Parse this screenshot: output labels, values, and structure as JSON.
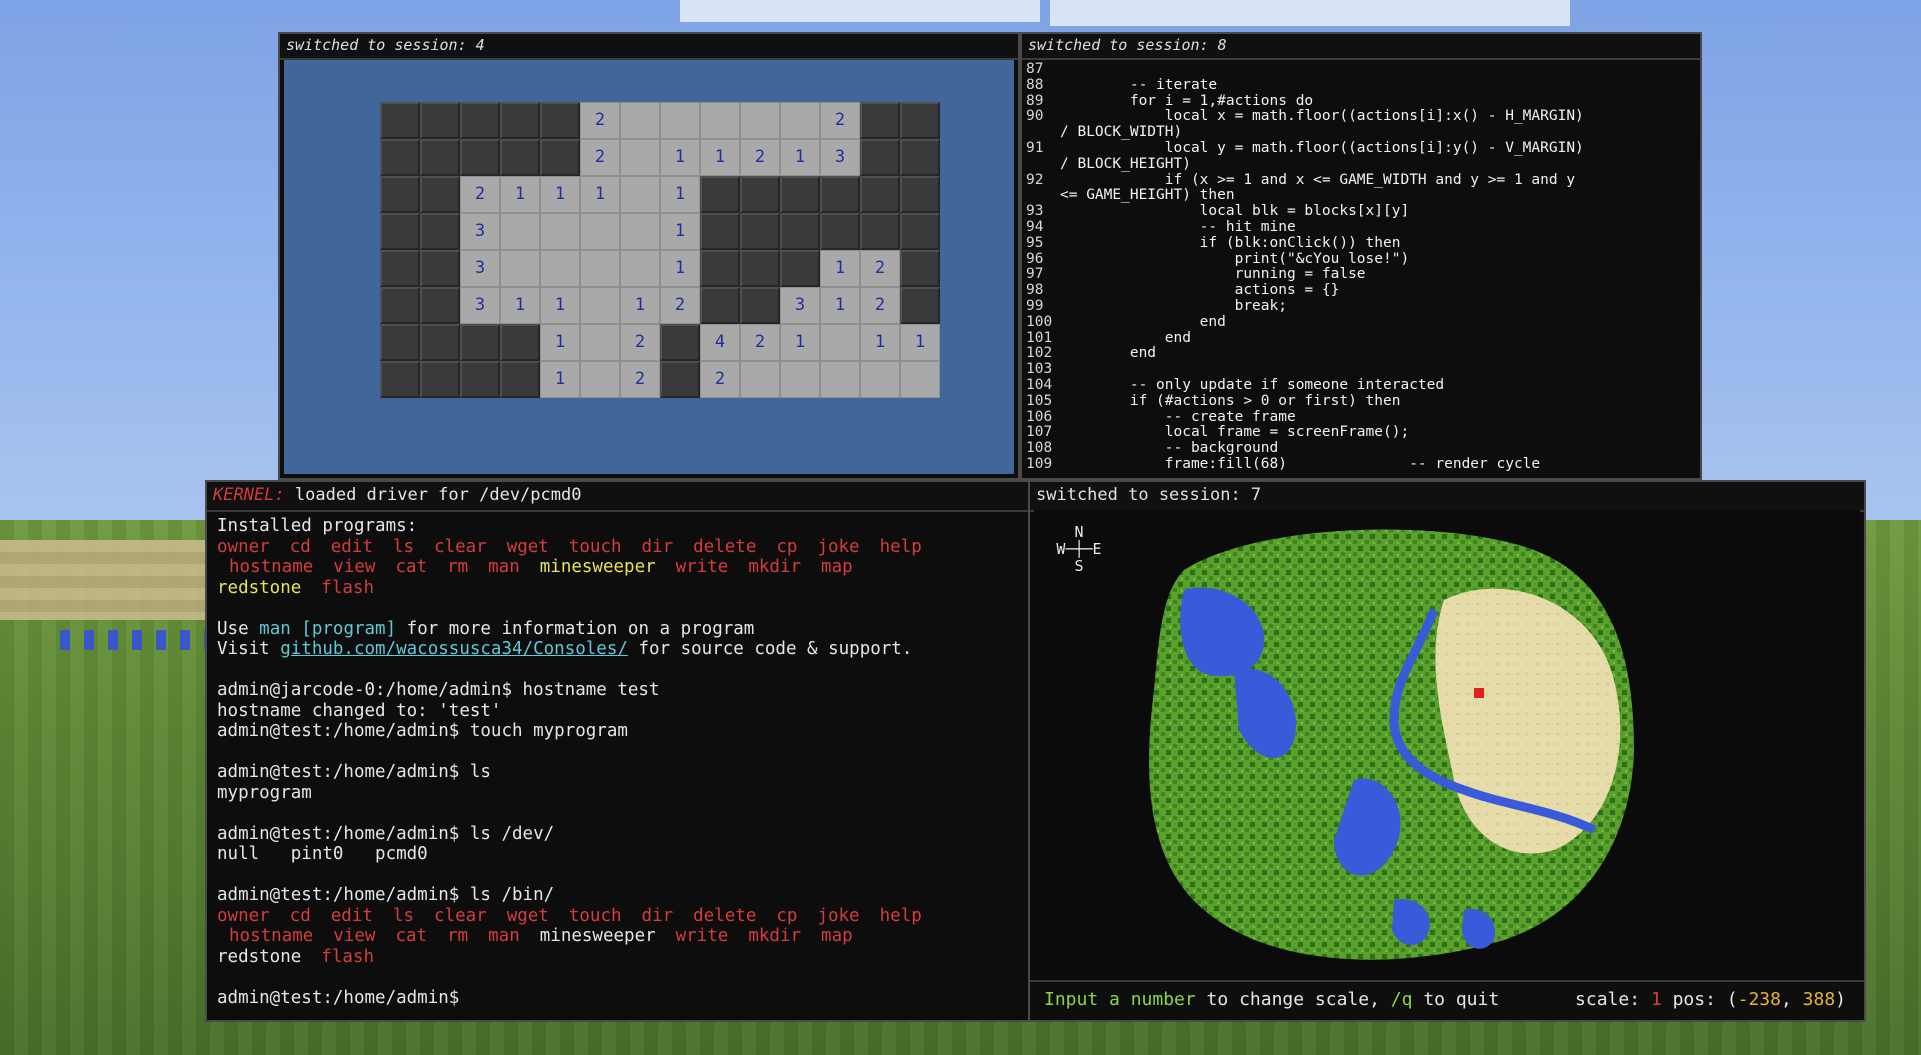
{
  "game_pane": {
    "header": "switched to session: 4",
    "grid": [
      [
        "h",
        "h",
        "h",
        "h",
        "h",
        "o:2",
        "o",
        "o",
        "o",
        "o",
        "o",
        "o:2",
        "h",
        "h"
      ],
      [
        "h",
        "h",
        "h",
        "h",
        "h",
        "o:2",
        "o",
        "o:1",
        "o:1",
        "o:2",
        "o:1",
        "o:3",
        "h",
        "h"
      ],
      [
        "h",
        "h",
        "o:2",
        "o:1",
        "o:1",
        "o:1",
        "o",
        "o:1",
        "h",
        "h",
        "h",
        "h",
        "h",
        "h"
      ],
      [
        "h",
        "h",
        "o:3",
        "o",
        "o",
        "o",
        "o",
        "o:1",
        "h",
        "h",
        "h",
        "h",
        "h",
        "h"
      ],
      [
        "h",
        "h",
        "o:3",
        "o",
        "o",
        "o",
        "o",
        "o:1",
        "h",
        "h",
        "h",
        "o:1",
        "o:2",
        "h"
      ],
      [
        "h",
        "h",
        "o:3",
        "o:1",
        "o:1",
        "o",
        "o:1",
        "o:2",
        "h",
        "h",
        "o:3",
        "o:1",
        "o:2",
        "h"
      ],
      [
        "h",
        "h",
        "h",
        "h",
        "o:1",
        "o",
        "o:2",
        "h",
        "o:4",
        "o:2",
        "o:1",
        "o",
        "o:1",
        "o:1"
      ],
      [
        "h",
        "h",
        "h",
        "h",
        "o:1",
        "o",
        "o:2",
        "h",
        "o:2",
        "o",
        "o",
        "o",
        "o",
        "o"
      ]
    ]
  },
  "code_pane": {
    "header": "switched to session: 8",
    "lines": [
      {
        "n": "87",
        "t": ""
      },
      {
        "n": "88",
        "t": "        -- iterate"
      },
      {
        "n": "89",
        "t": "        for i = 1,#actions do"
      },
      {
        "n": "90",
        "t": "            local x = math.floor((actions[i]:x() - H_MARGIN)"
      },
      {
        "n": "",
        "t": "/ BLOCK_WIDTH)"
      },
      {
        "n": "91",
        "t": "            local y = math.floor((actions[i]:y() - V_MARGIN)"
      },
      {
        "n": "",
        "t": "/ BLOCK_HEIGHT)"
      },
      {
        "n": "92",
        "t": "            if (x >= 1 and x <= GAME_WIDTH and y >= 1 and y"
      },
      {
        "n": "",
        "t": "<= GAME_HEIGHT) then"
      },
      {
        "n": "93",
        "t": "                local blk = blocks[x][y]"
      },
      {
        "n": "94",
        "t": "                -- hit mine"
      },
      {
        "n": "95",
        "t": "                if (blk:onClick()) then"
      },
      {
        "n": "96",
        "t": "                    print(\"&cYou lose!\")"
      },
      {
        "n": "97",
        "t": "                    running = false"
      },
      {
        "n": "98",
        "t": "                    actions = {}"
      },
      {
        "n": "99",
        "t": "                    break;"
      },
      {
        "n": "100",
        "t": "                end"
      },
      {
        "n": "101",
        "t": "            end"
      },
      {
        "n": "102",
        "t": "        end"
      },
      {
        "n": "103",
        "t": ""
      },
      {
        "n": "104",
        "t": "        -- only update if someone interacted"
      },
      {
        "n": "105",
        "t": "        if (#actions > 0 or first) then"
      },
      {
        "n": "106",
        "t": "            -- create frame"
      },
      {
        "n": "107",
        "t": "            local frame = screenFrame();"
      },
      {
        "n": "108",
        "t": "            -- background"
      },
      {
        "n": "109",
        "t": "            frame:fill(68)              -- render cycle"
      }
    ]
  },
  "shell_pane": {
    "kernel_label": "KERNEL:",
    "kernel_msg": " loaded driver for /dev/pcmd0",
    "installed": "Installed programs:",
    "programs_row1": [
      "owner",
      "cd",
      "edit",
      "ls",
      "clear",
      "wget",
      "touch",
      "dir",
      "delete",
      "cp",
      "joke",
      "help"
    ],
    "programs_row2": [
      "hostname",
      "view",
      "cat",
      "rm",
      "man",
      "minesweeper",
      "write",
      "mkdir",
      "map"
    ],
    "programs_row2_highlight": "minesweeper",
    "programs_row3": [
      "redstone",
      "flash"
    ],
    "use_pre": "Use ",
    "use_cmd": "man [program]",
    "use_post": " for more information on a program",
    "visit_pre": "Visit ",
    "visit_link": "github.com/wacossusca34/Consoles/",
    "visit_post": " for source code & support.",
    "history": [
      "admin@jarcode-0:/home/admin$ hostname test",
      "hostname changed to: 'test'",
      "admin@test:/home/admin$ touch myprogram",
      "",
      "admin@test:/home/admin$ ls",
      "myprogram",
      "",
      "admin@test:/home/admin$ ls /dev/",
      "null   pint0   pcmd0",
      "",
      "admin@test:/home/admin$ ls /bin/"
    ],
    "bin_row1": [
      "owner",
      "cd",
      "edit",
      "ls",
      "clear",
      "wget",
      "touch",
      "dir",
      "delete",
      "cp",
      "joke",
      "help"
    ],
    "bin_row2": [
      "hostname",
      "view",
      "cat",
      "rm",
      "man",
      "minesweeper",
      "write",
      "mkdir",
      "map"
    ],
    "bin_row3": [
      "redstone",
      "flash"
    ],
    "prompt": "admin@test:/home/admin$"
  },
  "map_pane": {
    "header": "switched to session: 7",
    "compass": {
      "n": "N",
      "w": "W",
      "e": "E",
      "s": "S"
    },
    "footer_green1": "Input a number",
    "footer_mid": " to change scale, ",
    "footer_green2": "/q",
    "footer_quit": " to quit       scale: ",
    "scale": "1",
    "pos_label": " pos: (",
    "pos_x": "-238",
    "pos_sep": ", ",
    "pos_y": "388",
    "pos_close": ")"
  },
  "colors": {
    "water": "#3a5bd9",
    "grass": "#5aa02c",
    "forest": "#2f6f18",
    "sand": "#e6dcaa",
    "error": "#d63c3c",
    "highlight": "#e8e35a"
  }
}
